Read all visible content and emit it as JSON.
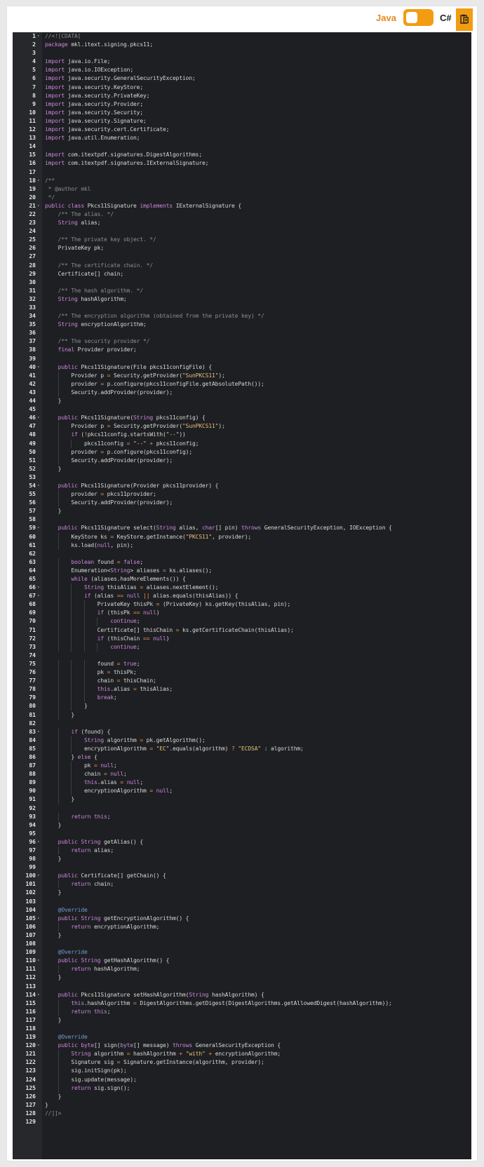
{
  "toolbar": {
    "java_label": "Java",
    "csharp_label": "C#",
    "toggle_state": "java",
    "copy_icon": "clipboard-icon",
    "accent_color": "#f39c12"
  },
  "editor": {
    "language": "java",
    "lines": [
      "//<![CDATA[",
      "package mkl.itext.signing.pkcs11;",
      "",
      "import java.io.File;",
      "import java.io.IOException;",
      "import java.security.GeneralSecurityException;",
      "import java.security.KeyStore;",
      "import java.security.PrivateKey;",
      "import java.security.Provider;",
      "import java.security.Security;",
      "import java.security.Signature;",
      "import java.security.cert.Certificate;",
      "import java.util.Enumeration;",
      "",
      "import com.itextpdf.signatures.DigestAlgorithms;",
      "import com.itextpdf.signatures.IExternalSignature;",
      "",
      "/**",
      " * @author mkl",
      " */",
      "public class Pkcs11Signature implements IExternalSignature {",
      "    /** The alias. */",
      "    String alias;",
      "",
      "    /** The private key object. */",
      "    PrivateKey pk;",
      "",
      "    /** The certificate chain. */",
      "    Certificate[] chain;",
      "",
      "    /** The hash algorithm. */",
      "    String hashAlgorithm;",
      "",
      "    /** The encryption algorithm (obtained from the private key) */",
      "    String encryptionAlgorithm;",
      "",
      "    /** The security provider */",
      "    final Provider provider;",
      "",
      "    public Pkcs11Signature(File pkcs11configFile) {",
      "        Provider p = Security.getProvider(\"SunPKCS11\");",
      "        provider = p.configure(pkcs11configFile.getAbsolutePath());",
      "        Security.addProvider(provider);",
      "    }",
      "",
      "    public Pkcs11Signature(String pkcs11config) {",
      "        Provider p = Security.getProvider(\"SunPKCS11\");",
      "        if (!pkcs11config.startsWith(\"--\"))",
      "            pkcs11config = \"--\" + pkcs11config;",
      "        provider = p.configure(pkcs11config);",
      "        Security.addProvider(provider);",
      "    }",
      "",
      "    public Pkcs11Signature(Provider pkcs11provider) {",
      "        provider = pkcs11provider;",
      "        Security.addProvider(provider);",
      "    }",
      "",
      "    public Pkcs11Signature select(String alias, char[] pin) throws GeneralSecurityException, IOException {",
      "        KeyStore ks = KeyStore.getInstance(\"PKCS11\", provider);",
      "        ks.load(null, pin);",
      "",
      "        boolean found = false;",
      "        Enumeration<String> aliases = ks.aliases();",
      "        while (aliases.hasMoreElements()) {",
      "            String thisAlias = aliases.nextElement();",
      "            if (alias == null || alias.equals(thisAlias)) {",
      "                PrivateKey thisPk = (PrivateKey) ks.getKey(thisAlias, pin);",
      "                if (thisPk == null)",
      "                    continue;",
      "                Certificate[] thisChain = ks.getCertificateChain(thisAlias);",
      "                if (thisChain == null)",
      "                    continue;",
      "",
      "                found = true;",
      "                pk = thisPk;",
      "                chain = thisChain;",
      "                this.alias = thisAlias;",
      "                break;",
      "            }",
      "        }",
      "",
      "        if (found) {",
      "            String algorithm = pk.getAlgorithm();",
      "            encryptionAlgorithm = \"EC\".equals(algorithm) ? \"ECDSA\" : algorithm;",
      "        } else {",
      "            pk = null;",
      "            chain = null;",
      "            this.alias = null;",
      "            encryptionAlgorithm = null;",
      "        }",
      "",
      "        return this;",
      "    }",
      "",
      "    public String getAlias() {",
      "        return alias;",
      "    }",
      "",
      "    public Certificate[] getChain() {",
      "        return chain;",
      "    }",
      "",
      "    @Override",
      "    public String getEncryptionAlgorithm() {",
      "        return encryptionAlgorithm;",
      "    }",
      "",
      "    @Override",
      "    public String getHashAlgorithm() {",
      "        return hashAlgorithm;",
      "    }",
      "",
      "    public Pkcs11Signature setHashAlgorithm(String hashAlgorithm) {",
      "        this.hashAlgorithm = DigestAlgorithms.getDigest(DigestAlgorithms.getAllowedDigest(hashAlgorithm));",
      "        return this;",
      "    }",
      "",
      "    @Override",
      "    public byte[] sign(byte[] message) throws GeneralSecurityException {",
      "        String algorithm = hashAlgorithm + \"with\" + encryptionAlgorithm;",
      "        Signature sig = Signature.getInstance(algorithm, provider);",
      "        sig.initSign(pk);",
      "        sig.update(message);",
      "        return sig.sign();",
      "    }",
      "}",
      "//]]>",
      ""
    ],
    "fold_lines": [
      1,
      18,
      21,
      40,
      46,
      54,
      59,
      66,
      67,
      83,
      96,
      100,
      105,
      110,
      114,
      120
    ]
  }
}
